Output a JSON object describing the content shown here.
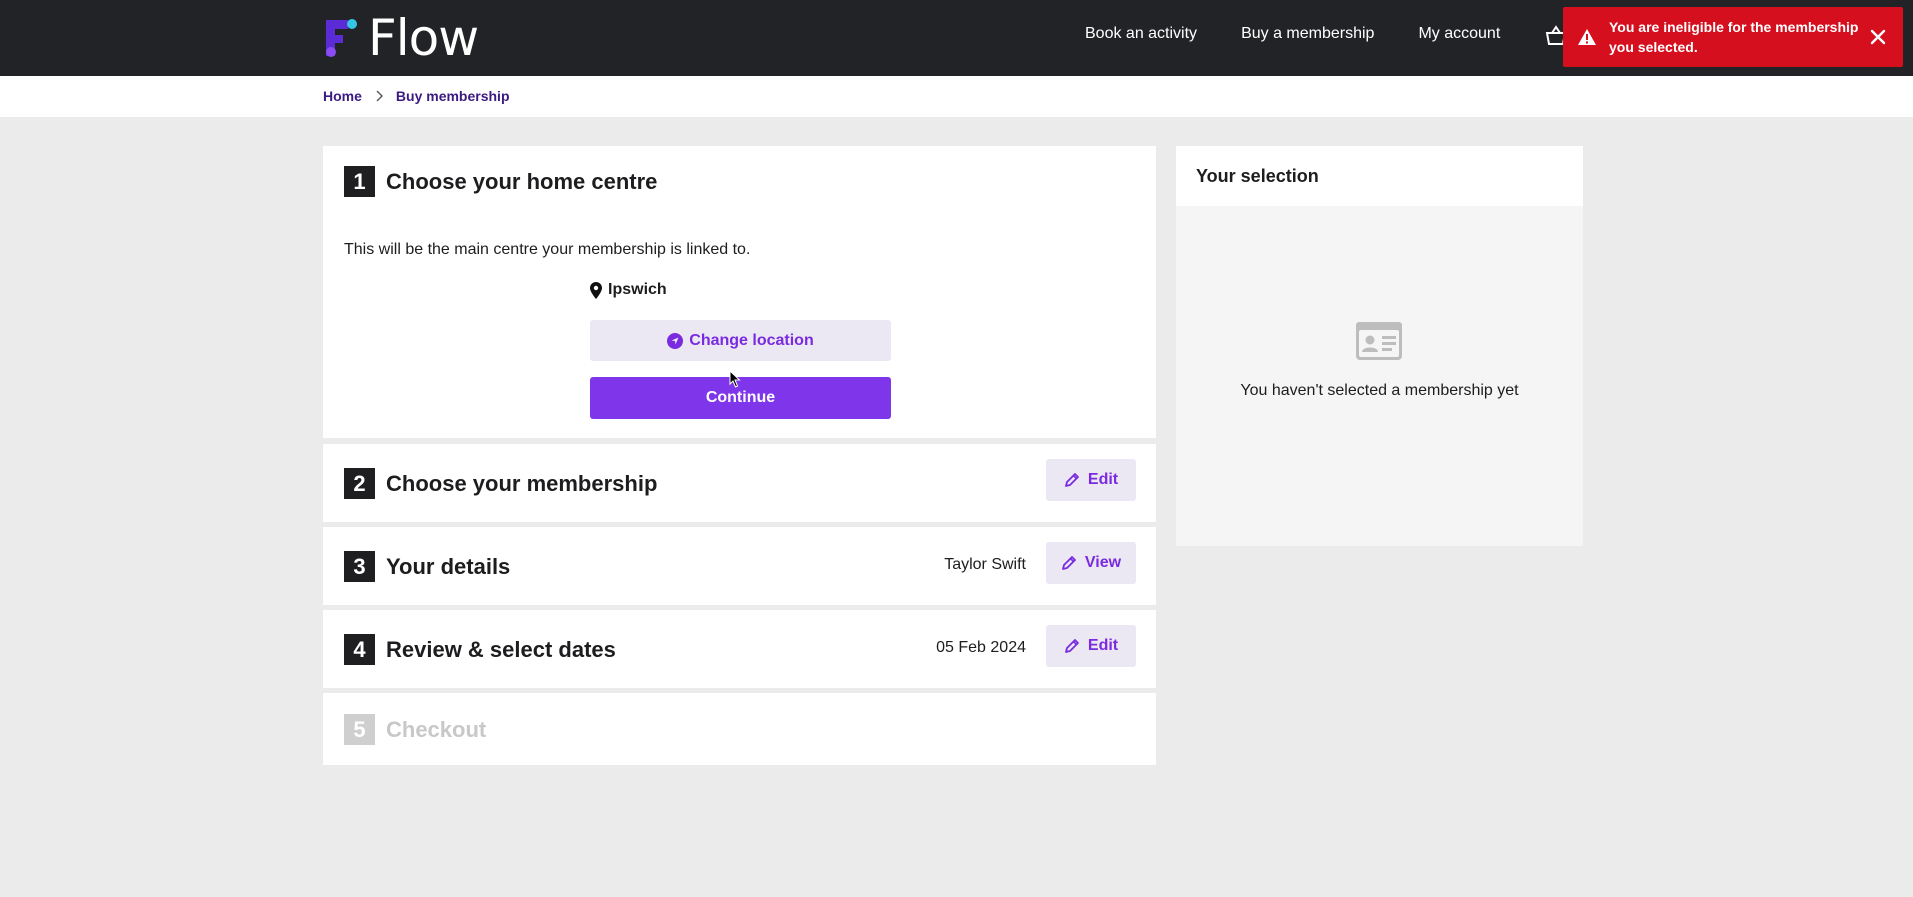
{
  "header": {
    "brand": "Flow",
    "nav": [
      {
        "label": "Book an activity"
      },
      {
        "label": "Buy a membership"
      },
      {
        "label": "My account"
      }
    ]
  },
  "toast": {
    "message": "You are ineligible for the membership you selected.",
    "color": "#d50f1e"
  },
  "breadcrumb": {
    "home": "Home",
    "current": "Buy membership"
  },
  "steps": {
    "step1": {
      "number": "1",
      "title": "Choose your home centre",
      "intro": "This will be the main centre your membership is linked to.",
      "location": "Ipswich",
      "change_label": "Change location",
      "continue_label": "Continue"
    },
    "step2": {
      "number": "2",
      "title": "Choose your membership",
      "action": "Edit"
    },
    "step3": {
      "number": "3",
      "title": "Your details",
      "summary": "Taylor Swift",
      "action": "View"
    },
    "step4": {
      "number": "4",
      "title": "Review & select dates",
      "summary": "05 Feb 2024",
      "action": "Edit"
    },
    "step5": {
      "number": "5",
      "title": "Checkout"
    }
  },
  "selection": {
    "title": "Your selection",
    "empty_text": "You haven't selected a membership yet"
  },
  "colors": {
    "accent": "#7f35ea",
    "header_bg": "#222326"
  }
}
